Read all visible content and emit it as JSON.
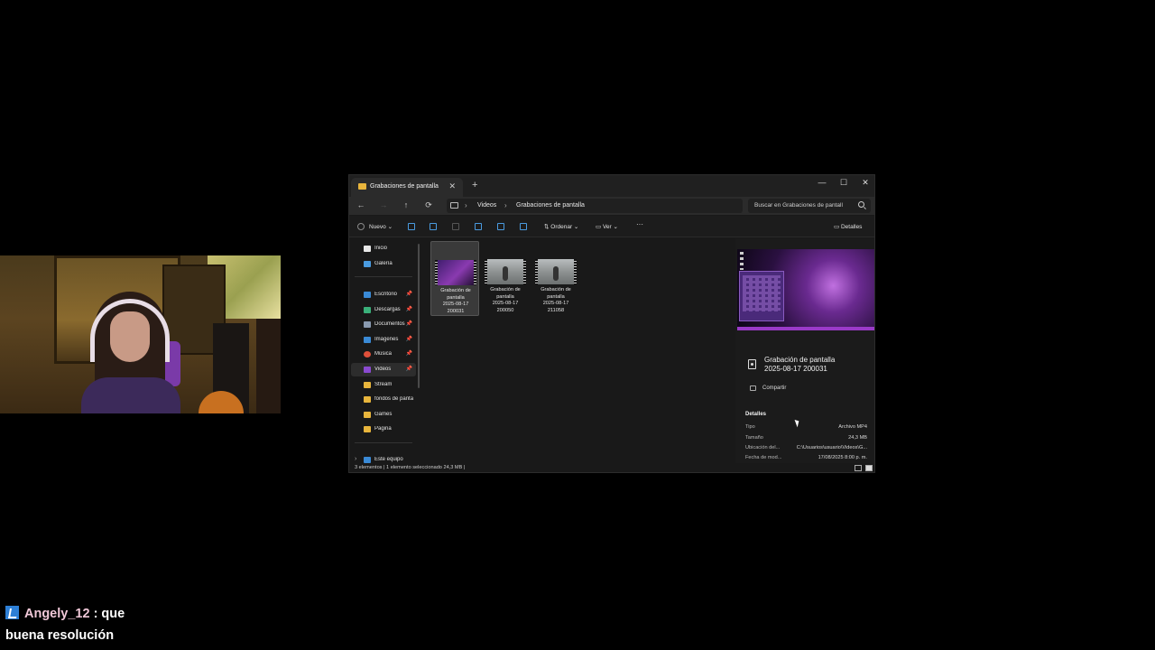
{
  "chat": {
    "username": "Angely_12",
    "message_prefix": " : que",
    "message_line2": "buena resolución"
  },
  "explorer": {
    "tab_title": "Grabaciones de pantalla",
    "tab_close": "✕",
    "new_tab": "+",
    "window_controls": {
      "minimize": "—",
      "maximize": "☐",
      "close": "✕"
    },
    "nav": {
      "back": "←",
      "forward": "→",
      "up": "↑",
      "refresh": "⟳"
    },
    "breadcrumb": [
      "Videos",
      "Grabaciones de pantalla"
    ],
    "breadcrumb_sep": "›",
    "search_placeholder": "Buscar en Grabaciones de pantall",
    "toolbar": {
      "new_label": "Nuevo",
      "sort_label": "Ordenar",
      "view_label": "Ver",
      "more_label": "···",
      "details_label": "Detalles"
    },
    "sidebar": {
      "items": [
        {
          "label": "Inicio",
          "icon": "home-icon",
          "color": "#e8e8e8"
        },
        {
          "label": "Galería",
          "icon": "gallery-icon",
          "color": "#4a9be0"
        },
        {
          "label": "Escritorio",
          "icon": "desktop-icon",
          "color": "#3a8ad6",
          "pinned": true
        },
        {
          "label": "Descargas",
          "icon": "download-icon",
          "color": "#3ab07a",
          "pinned": true
        },
        {
          "label": "Documentos",
          "icon": "document-icon",
          "color": "#8a9ab0",
          "pinned": true
        },
        {
          "label": "Imágenes",
          "icon": "image-icon",
          "color": "#3a8ad6",
          "pinned": true
        },
        {
          "label": "Música",
          "icon": "music-icon",
          "color": "#e0503a",
          "pinned": true
        },
        {
          "label": "Videos",
          "icon": "video-icon",
          "color": "#8a4ad0",
          "pinned": true,
          "selected": true
        },
        {
          "label": "Stream",
          "icon": "folder-icon",
          "color": "#e8b53c"
        },
        {
          "label": "fondos de panta",
          "icon": "folder-icon",
          "color": "#e8b53c"
        },
        {
          "label": "Games",
          "icon": "folder-icon",
          "color": "#e8b53c"
        },
        {
          "label": "Pagina",
          "icon": "folder-icon",
          "color": "#e8b53c"
        },
        {
          "label": "Este equipo",
          "icon": "pc-icon",
          "color": "#3a8ad6"
        }
      ],
      "pin_glyph": "📌",
      "expand_glyph": "›"
    },
    "files": [
      {
        "name_l1": "Grabación de",
        "name_l2": "pantalla",
        "name_l3": "2025-08-17",
        "name_l4": "200031",
        "thumb": "purple"
      },
      {
        "name_l1": "Grabación de",
        "name_l2": "pantalla",
        "name_l3": "2025-08-17",
        "name_l4": "200050",
        "thumb": "gray"
      },
      {
        "name_l1": "Grabación de",
        "name_l2": "pantalla",
        "name_l3": "2025-08-17",
        "name_l4": "211058",
        "thumb": "gray"
      }
    ],
    "details": {
      "title_l1": "Grabación de pantalla",
      "title_l2": "2025-08-17 200031",
      "share_label": "Compartir",
      "section_title": "Detalles",
      "rows": [
        {
          "key": "Tipo",
          "value": "Archivo MP4"
        },
        {
          "key": "Tamaño",
          "value": "24,3 MB"
        },
        {
          "key": "Ubicación del...",
          "value": "C:\\Usuarios\\usuario\\Videos\\G..."
        },
        {
          "key": "Fecha de mod...",
          "value": "17/08/2025 8:00 p. m."
        }
      ]
    },
    "status": "3 elementos   |   1 elemento seleccionado 24,3 MB   |"
  }
}
